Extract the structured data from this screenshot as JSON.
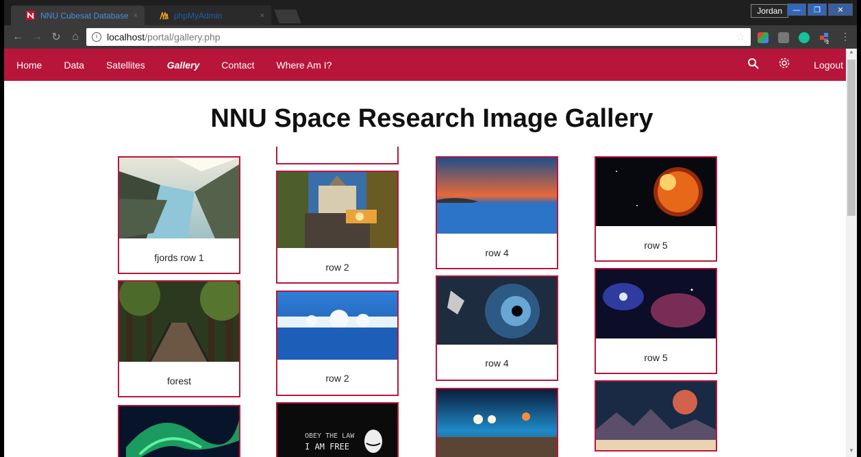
{
  "browser": {
    "tabs": [
      {
        "title": "NNU Cubesat Database",
        "close": "×"
      },
      {
        "title": "phpMyAdmin",
        "close": "×"
      }
    ],
    "profile": "Jordan",
    "window_buttons": [
      "—",
      "❐",
      "✕"
    ],
    "url_host": "localhost",
    "url_path": "/portal/gallery.php",
    "ext_badge": "2"
  },
  "nav": {
    "links": [
      "Home",
      "Data",
      "Satellites",
      "Gallery",
      "Contact",
      "Where Am I?"
    ],
    "active": "Gallery",
    "logout": "Logout"
  },
  "page": {
    "title": "NNU Space Research Image Gallery"
  },
  "gallery": [
    {
      "caption": "fjords row 1",
      "scene": "fjords"
    },
    {
      "caption": "forest",
      "scene": "forest"
    },
    {
      "caption": "",
      "scene": "aurora"
    },
    {
      "caption": "",
      "scene": "blank"
    },
    {
      "caption": "row 2",
      "scene": "street"
    },
    {
      "caption": "row 2",
      "scene": "winter-lake"
    },
    {
      "caption": "",
      "scene": "mask",
      "overlay_lines": [
        "OBEY THE LAW",
        "I AM FREE"
      ]
    },
    {
      "caption": "row 4",
      "scene": "sunset-sea"
    },
    {
      "caption": "row 4",
      "scene": "astronaut-wormhole"
    },
    {
      "caption": "",
      "scene": "bokeh-table"
    },
    {
      "caption": "row 5",
      "scene": "burning-planet"
    },
    {
      "caption": "row 5",
      "scene": "nebula"
    },
    {
      "caption": "",
      "scene": "alien-planet"
    }
  ],
  "colors": {
    "brand": "#b8153a",
    "chrome_dark": "#1f1f1f"
  }
}
